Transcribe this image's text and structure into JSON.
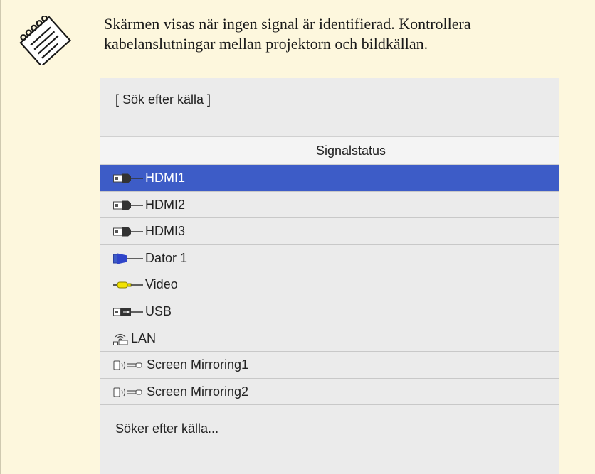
{
  "note": {
    "text": "Skärmen visas när ingen signal är identifierad. Kontrollera kabelanslutningar mellan projektorn och bildkällan."
  },
  "osd": {
    "title": "[ Sök efter källa ]",
    "header": "Signalstatus",
    "status": "Söker efter källa...",
    "selected_color": "#3d5cc7",
    "sources": [
      {
        "label": "HDMI1",
        "icon": "hdmi-icon",
        "selected": true
      },
      {
        "label": "HDMI2",
        "icon": "hdmi-icon",
        "selected": false
      },
      {
        "label": "HDMI3",
        "icon": "hdmi-icon",
        "selected": false
      },
      {
        "label": "Dator 1",
        "icon": "vga-computer-icon",
        "selected": false
      },
      {
        "label": "Video",
        "icon": "video-rca-icon",
        "selected": false
      },
      {
        "label": "USB",
        "icon": "usb-icon",
        "selected": false
      },
      {
        "label": "LAN",
        "icon": "lan-wireless-icon",
        "selected": false
      },
      {
        "label": "Screen Mirroring1",
        "icon": "screen-mirroring-icon",
        "selected": false
      },
      {
        "label": "Screen Mirroring2",
        "icon": "screen-mirroring-icon",
        "selected": false
      }
    ]
  }
}
